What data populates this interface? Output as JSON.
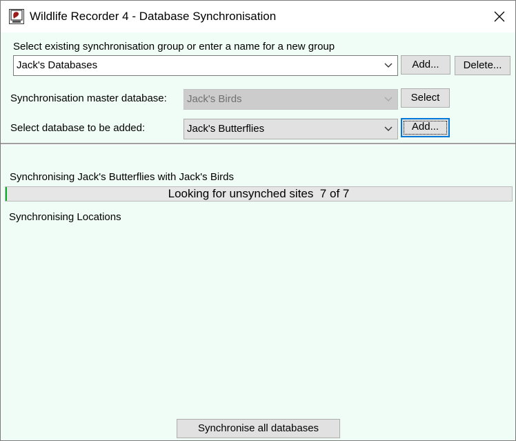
{
  "window": {
    "title": "Wildlife Recorder 4 - Database Synchronisation"
  },
  "group": {
    "prompt": "Select existing synchronisation group or enter a name for a new group",
    "value": "Jack's Databases",
    "add_label": "Add...",
    "delete_label": "Delete..."
  },
  "master": {
    "label": "Synchronisation master database:",
    "value": "Jack's Birds",
    "select_label": "Select"
  },
  "add_db": {
    "label": "Select database to be added:",
    "value": "Jack's Butterflies",
    "add_label": "Add..."
  },
  "status": {
    "line": "Synchronising Jack's Butterflies with Jack's Birds",
    "progress_text": "Looking for unsynched sites  7 of 7",
    "progress_fraction": 0.003,
    "phase": "Synchronising Locations"
  },
  "footer": {
    "sync_all_label": "Synchronise all databases"
  },
  "icons": {
    "app": "app-icon",
    "close": "close-icon",
    "dropdown": "chevron-down-icon"
  },
  "colors": {
    "accent": "#0078d7",
    "progress": "#06b025",
    "background": "#f0fcf6"
  }
}
